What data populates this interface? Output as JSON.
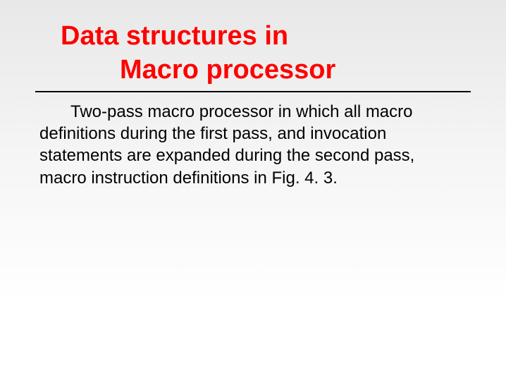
{
  "slide": {
    "title_line1": "Data structures  in",
    "title_line2": "Macro processor",
    "body": "Two-pass macro processor in which all macro definitions during the first pass, and invocation statements are expanded during the second pass, macro instruction definitions in Fig. 4. 3."
  }
}
